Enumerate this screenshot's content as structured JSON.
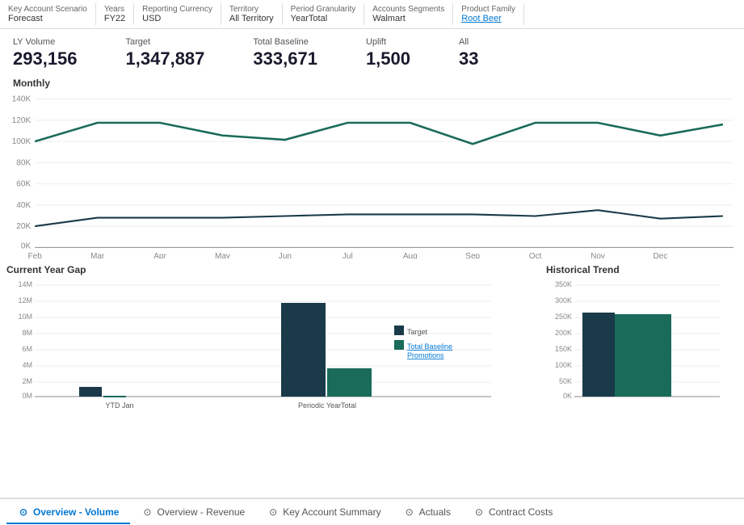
{
  "app": {
    "title": "Key Account Scenario Forecast"
  },
  "filters": [
    {
      "id": "scenario",
      "label": "Key Account Scenario",
      "value": "Forecast",
      "link": false
    },
    {
      "id": "years",
      "label": "Years",
      "value": "FY22",
      "link": false
    },
    {
      "id": "currency",
      "label": "Reporting Currency",
      "value": "USD",
      "link": false
    },
    {
      "id": "territory",
      "label": "Territory",
      "value": "All Territory",
      "link": false
    },
    {
      "id": "granularity",
      "label": "Period Granularity",
      "value": "YearTotal",
      "link": false
    },
    {
      "id": "segments",
      "label": "Accounts Segments",
      "value": "Walmart",
      "link": false
    },
    {
      "id": "product",
      "label": "Product Family",
      "value": "Root Beer",
      "link": true
    }
  ],
  "kpis": [
    {
      "label": "LY Volume",
      "value": "293,156"
    },
    {
      "label": "Target",
      "value": "1,347,887"
    },
    {
      "label": "Total Baseline",
      "value": "333,671"
    },
    {
      "label": "Uplift",
      "value": "1,500"
    },
    {
      "label": "All",
      "value": "33..."
    }
  ],
  "monthly_chart": {
    "title": "Monthly",
    "y_labels": [
      "140K",
      "120K",
      "100K",
      "80K",
      "60K",
      "40K",
      "20K",
      "0K"
    ],
    "x_labels": [
      "Feb",
      "Mar",
      "Apr",
      "May",
      "Jun",
      "Jul",
      "Aug",
      "Sep",
      "Oct",
      "Nov",
      "Dec"
    ],
    "series1_color": "#1a6b5a",
    "series2_color": "#1a3a4a"
  },
  "gap_chart": {
    "title": "Current Year Gap",
    "y_labels": [
      "14M",
      "12M",
      "10M",
      "8M",
      "6M",
      "4M",
      "2M",
      "0M"
    ],
    "x_labels": [
      "YTD Jan",
      "Periodic YearTotal"
    ],
    "legend": [
      {
        "label": "Target",
        "color": "#1a3a4a"
      },
      {
        "label": "Total Baseline Promotions",
        "color": "#1a6b5a"
      }
    ],
    "bars": {
      "ytd_target": 1.2,
      "ytd_baseline": 0.08,
      "periodic_target": 11.8,
      "periodic_baseline": 3.6
    }
  },
  "historical_chart": {
    "title": "Historical Trend",
    "y_labels": [
      "350K",
      "300K",
      "250K",
      "200K",
      "150K",
      "100K",
      "50K",
      "0K"
    ],
    "bar_color": "#1a6b5a"
  },
  "tabs": [
    {
      "id": "overview-volume",
      "label": "Overview - Volume",
      "active": true
    },
    {
      "id": "overview-revenue",
      "label": "Overview - Revenue",
      "active": false
    },
    {
      "id": "key-account-summary",
      "label": "Key Account Summary",
      "active": false
    },
    {
      "id": "actuals",
      "label": "Actuals",
      "active": false
    },
    {
      "id": "contract-costs",
      "label": "Contract Costs",
      "active": false
    }
  ]
}
